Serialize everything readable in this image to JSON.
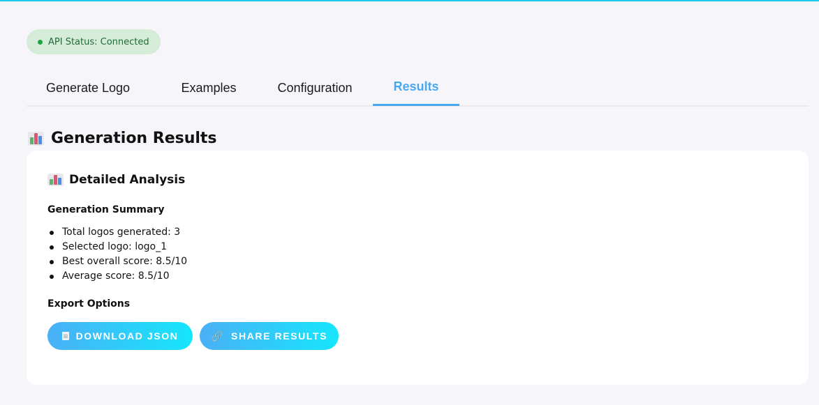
{
  "status": {
    "label": "API Status: Connected",
    "color": "#22a344"
  },
  "tabs": [
    {
      "label": "Generate Logo",
      "active": false
    },
    {
      "label": "Examples",
      "active": false
    },
    {
      "label": "Configuration",
      "active": false
    },
    {
      "label": "Results",
      "active": true
    }
  ],
  "page": {
    "title": "Generation Results",
    "icon": "bar-chart-icon"
  },
  "card": {
    "title": "Detailed Analysis",
    "icon": "bar-chart-icon",
    "summary_heading": "Generation Summary",
    "summary_items": [
      "Total logos generated: 3",
      "Selected logo: logo_1",
      "Best overall score: 8.5/10",
      "Average score: 8.5/10"
    ],
    "export_heading": "Export Options",
    "buttons": {
      "download_json": {
        "label": "DOWNLOAD JSON",
        "icon": "document-icon"
      },
      "share_results": {
        "label": "SHARE RESULTS",
        "icon": "link-icon"
      }
    }
  },
  "colors": {
    "accent": "#4aa8f0",
    "button_gradient_start": "#4ab0f6",
    "button_gradient_end": "#16e6fc"
  }
}
